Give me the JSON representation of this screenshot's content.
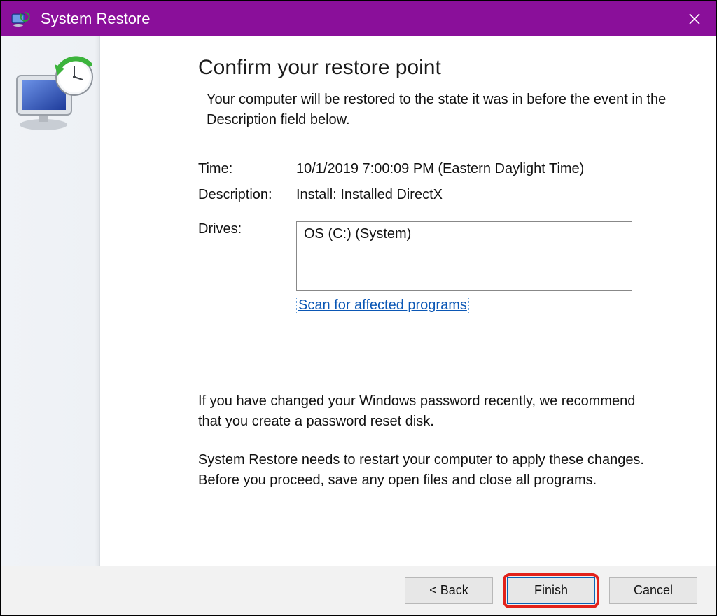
{
  "titlebar": {
    "title": "System Restore"
  },
  "main": {
    "heading": "Confirm your restore point",
    "intro": "Your computer will be restored to the state it was in before the event in the Description field below.",
    "time_label": "Time:",
    "time_value": "10/1/2019 7:00:09 PM (Eastern Daylight Time)",
    "description_label": "Description:",
    "description_value": "Install: Installed DirectX",
    "drives_label": "Drives:",
    "drives_value": "OS (C:) (System)",
    "scan_link": "Scan for affected programs",
    "note_password": "If you have changed your Windows password recently, we recommend that you create a password reset disk.",
    "note_restart": "System Restore needs to restart your computer to apply these changes. Before you proceed, save any open files and close all programs."
  },
  "footer": {
    "back": "< Back",
    "finish": "Finish",
    "cancel": "Cancel"
  }
}
